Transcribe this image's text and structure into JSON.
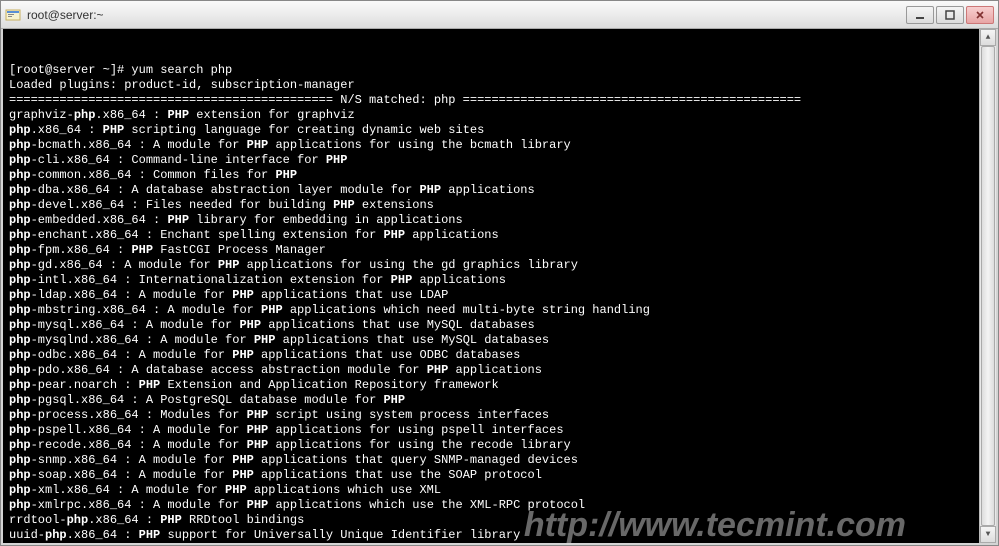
{
  "window": {
    "title": "root@server:~"
  },
  "terminal": {
    "prompt": "[root@server ~]# ",
    "command": "yum search php",
    "plugins_line": "Loaded plugins: product-id, subscription-manager",
    "divider_left": "============================================= ",
    "match_label": "N/S matched: php",
    "divider_right": " ===============================================",
    "packages": [
      {
        "prefix": "graphviz-",
        "bold1": "php",
        "mid": ".x86_64 : ",
        "bold2": "PHP",
        "rest": " extension for graphviz"
      },
      {
        "prefix": "",
        "bold1": "php",
        "mid": ".x86_64 : ",
        "bold2": "PHP",
        "rest": " scripting language for creating dynamic web sites"
      },
      {
        "prefix": "",
        "bold1": "php",
        "mid": "-bcmath.x86_64 : A module for ",
        "bold2": "PHP",
        "rest": " applications for using the bcmath library"
      },
      {
        "prefix": "",
        "bold1": "php",
        "mid": "-cli.x86_64 : Command-line interface for ",
        "bold2": "PHP",
        "rest": ""
      },
      {
        "prefix": "",
        "bold1": "php",
        "mid": "-common.x86_64 : Common files for ",
        "bold2": "PHP",
        "rest": ""
      },
      {
        "prefix": "",
        "bold1": "php",
        "mid": "-dba.x86_64 : A database abstraction layer module for ",
        "bold2": "PHP",
        "rest": " applications"
      },
      {
        "prefix": "",
        "bold1": "php",
        "mid": "-devel.x86_64 : Files needed for building ",
        "bold2": "PHP",
        "rest": " extensions"
      },
      {
        "prefix": "",
        "bold1": "php",
        "mid": "-embedded.x86_64 : ",
        "bold2": "PHP",
        "rest": " library for embedding in applications"
      },
      {
        "prefix": "",
        "bold1": "php",
        "mid": "-enchant.x86_64 : Enchant spelling extension for ",
        "bold2": "PHP",
        "rest": " applications"
      },
      {
        "prefix": "",
        "bold1": "php",
        "mid": "-fpm.x86_64 : ",
        "bold2": "PHP",
        "rest": " FastCGI Process Manager"
      },
      {
        "prefix": "",
        "bold1": "php",
        "mid": "-gd.x86_64 : A module for ",
        "bold2": "PHP",
        "rest": " applications for using the gd graphics library"
      },
      {
        "prefix": "",
        "bold1": "php",
        "mid": "-intl.x86_64 : Internationalization extension for ",
        "bold2": "PHP",
        "rest": " applications"
      },
      {
        "prefix": "",
        "bold1": "php",
        "mid": "-ldap.x86_64 : A module for ",
        "bold2": "PHP",
        "rest": " applications that use LDAP"
      },
      {
        "prefix": "",
        "bold1": "php",
        "mid": "-mbstring.x86_64 : A module for ",
        "bold2": "PHP",
        "rest": " applications which need multi-byte string handling"
      },
      {
        "prefix": "",
        "bold1": "php",
        "mid": "-mysql.x86_64 : A module for ",
        "bold2": "PHP",
        "rest": " applications that use MySQL databases"
      },
      {
        "prefix": "",
        "bold1": "php",
        "mid": "-mysqlnd.x86_64 : A module for ",
        "bold2": "PHP",
        "rest": " applications that use MySQL databases"
      },
      {
        "prefix": "",
        "bold1": "php",
        "mid": "-odbc.x86_64 : A module for ",
        "bold2": "PHP",
        "rest": " applications that use ODBC databases"
      },
      {
        "prefix": "",
        "bold1": "php",
        "mid": "-pdo.x86_64 : A database access abstraction module for ",
        "bold2": "PHP",
        "rest": " applications"
      },
      {
        "prefix": "",
        "bold1": "php",
        "mid": "-pear.noarch : ",
        "bold2": "PHP",
        "rest": " Extension and Application Repository framework"
      },
      {
        "prefix": "",
        "bold1": "php",
        "mid": "-pgsql.x86_64 : A PostgreSQL database module for ",
        "bold2": "PHP",
        "rest": ""
      },
      {
        "prefix": "",
        "bold1": "php",
        "mid": "-process.x86_64 : Modules for ",
        "bold2": "PHP",
        "rest": " script using system process interfaces"
      },
      {
        "prefix": "",
        "bold1": "php",
        "mid": "-pspell.x86_64 : A module for ",
        "bold2": "PHP",
        "rest": " applications for using pspell interfaces"
      },
      {
        "prefix": "",
        "bold1": "php",
        "mid": "-recode.x86_64 : A module for ",
        "bold2": "PHP",
        "rest": " applications for using the recode library"
      },
      {
        "prefix": "",
        "bold1": "php",
        "mid": "-snmp.x86_64 : A module for ",
        "bold2": "PHP",
        "rest": " applications that query SNMP-managed devices"
      },
      {
        "prefix": "",
        "bold1": "php",
        "mid": "-soap.x86_64 : A module for ",
        "bold2": "PHP",
        "rest": " applications that use the SOAP protocol"
      },
      {
        "prefix": "",
        "bold1": "php",
        "mid": "-xml.x86_64 : A module for ",
        "bold2": "PHP",
        "rest": " applications which use XML"
      },
      {
        "prefix": "",
        "bold1": "php",
        "mid": "-xmlrpc.x86_64 : A module for ",
        "bold2": "PHP",
        "rest": " applications which use the XML-RPC protocol"
      },
      {
        "prefix": "rrdtool-",
        "bold1": "php",
        "mid": ".x86_64 : ",
        "bold2": "PHP",
        "rest": " RRDtool bindings"
      },
      {
        "prefix": "uuid-",
        "bold1": "php",
        "mid": ".x86_64 : ",
        "bold2": "PHP",
        "rest": " support for Universally Unique Identifier library"
      }
    ]
  },
  "watermark": "http://www.tecmint.com"
}
